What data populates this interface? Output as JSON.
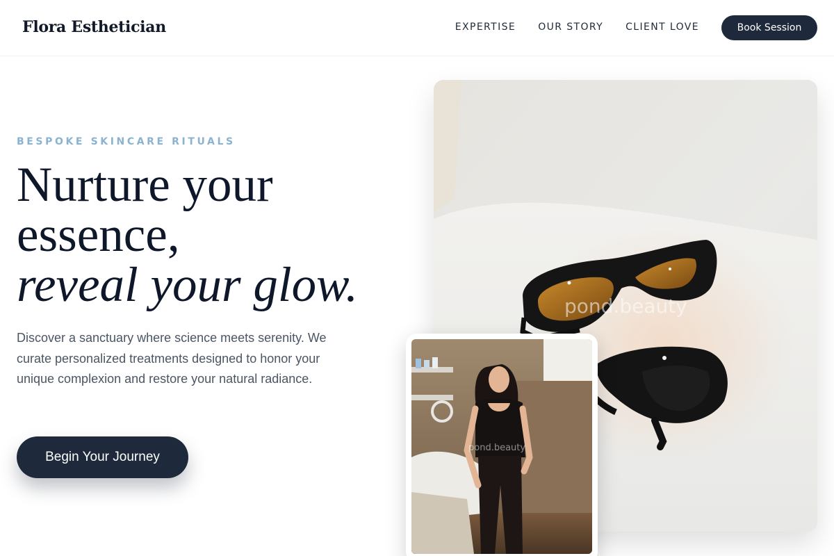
{
  "brand": {
    "name": "Flora Esthetician"
  },
  "nav": {
    "links": [
      "EXPERTISE",
      "OUR STORY",
      "CLIENT LOVE"
    ],
    "cta_label": "Book Session"
  },
  "hero": {
    "eyebrow": "BESPOKE SKINCARE RITUALS",
    "headline": {
      "line1": "Nurture your",
      "line2": "essence,",
      "line3": "reveal your glow."
    },
    "description": "Discover a sanctuary where science meets serenity. We curate personalized treatments designed to honor your unique complexion and restore your natural radiance.",
    "cta_label": "Begin Your Journey"
  },
  "images": {
    "main_watermark": "pond.beauty",
    "inset_watermark": "pond.beauty"
  },
  "colors": {
    "primary": "#1e293b",
    "accent": "#8bb2cf",
    "body_text": "#4b5563"
  }
}
